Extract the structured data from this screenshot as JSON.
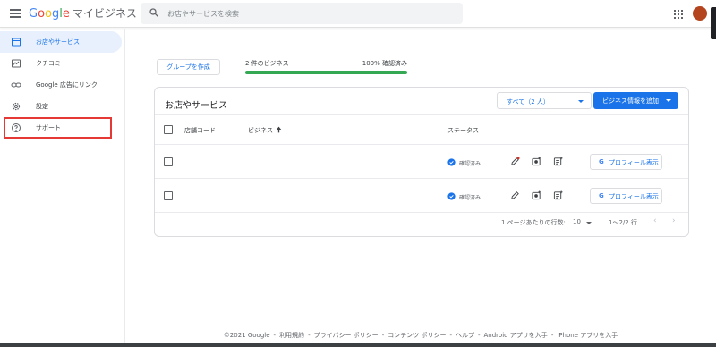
{
  "header": {
    "logo_google_letters": [
      "G",
      "o",
      "o",
      "g",
      "l",
      "e"
    ],
    "product_name": "マイビジネス",
    "search_placeholder": "お店やサービスを検索"
  },
  "sidebar": {
    "items": [
      {
        "label": "お店やサービス",
        "icon": "storefront-icon",
        "active": true
      },
      {
        "label": "クチコミ",
        "icon": "reviews-icon",
        "active": false
      },
      {
        "label": "Google 広告にリンク",
        "icon": "link-icon",
        "active": false
      },
      {
        "label": "設定",
        "icon": "gear-icon",
        "active": false
      },
      {
        "label": "サポート",
        "icon": "help-icon",
        "active": false,
        "highlighted": true
      }
    ]
  },
  "toolbar": {
    "group_button": "グループを作成",
    "progress_left": "2 件のビジネス",
    "progress_right": "100% 確認済み",
    "progress_fraction": 1.0
  },
  "card": {
    "title": "お店やサービス",
    "filter_value": "すべて（2 人）",
    "add_button": "ビジネス情報を追加",
    "columns": {
      "store_code": "店舗コード",
      "business": "ビジネス",
      "status": "ステータス"
    },
    "rows": [
      {
        "store_code": "",
        "business": "",
        "status": "確認済み",
        "profile_button": "プロフィール表示",
        "edit_has_dot": true
      },
      {
        "store_code": "",
        "business": "",
        "status": "確認済み",
        "profile_button": "プロフィール表示",
        "edit_has_dot": false
      }
    ],
    "profile_g": "G",
    "pagination": {
      "rows_per_page_label": "1 ページあたりの行数:",
      "rows_per_page_value": "10",
      "range": "1〜2/2 行",
      "prev": "‹",
      "next": "›"
    }
  },
  "footer": {
    "links": [
      "©2021 Google",
      "利用規約",
      "プライバシー ポリシー",
      "コンテンツ ポリシー",
      "ヘルプ",
      "Android アプリを入手",
      "iPhone アプリを入手"
    ],
    "separator": "-"
  },
  "colors": {
    "brand_blue": "#1a73e8",
    "progress_green": "#34a853",
    "highlight_red": "#e53935",
    "avatar": "#b3441e"
  }
}
